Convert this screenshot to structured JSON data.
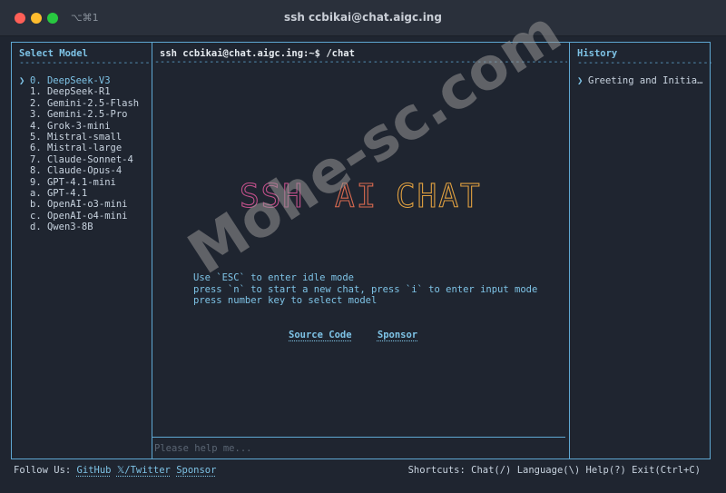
{
  "window": {
    "title": "ssh ccbikai@chat.aigc.ing",
    "tab_shortcut": "⌥⌘1"
  },
  "left_panel": {
    "title": "Select Model",
    "dashes": "--------------------------",
    "marker": "❯",
    "models": [
      {
        "key": "0.",
        "name": "DeepSeek-V3",
        "selected": true
      },
      {
        "key": "1.",
        "name": "DeepSeek-R1"
      },
      {
        "key": "2.",
        "name": "Gemini-2.5-Flash"
      },
      {
        "key": "3.",
        "name": "Gemini-2.5-Pro"
      },
      {
        "key": "4.",
        "name": "Grok-3-mini"
      },
      {
        "key": "5.",
        "name": "Mistral-small"
      },
      {
        "key": "6.",
        "name": "Mistral-large"
      },
      {
        "key": "7.",
        "name": "Claude-Sonnet-4"
      },
      {
        "key": "8.",
        "name": "Claude-Opus-4"
      },
      {
        "key": "9.",
        "name": "GPT-4.1-mini"
      },
      {
        "key": "a.",
        "name": "GPT-4.1"
      },
      {
        "key": "b.",
        "name": "OpenAI-o3-mini"
      },
      {
        "key": "c.",
        "name": "OpenAI-o4-mini"
      },
      {
        "key": "d.",
        "name": "Qwen3-8B"
      }
    ]
  },
  "main": {
    "prompt_title": "ssh ccbikai@chat.aigc.ing:~$ /chat",
    "dashes": "------------------------------------------------------------------------------------------",
    "banner": {
      "words": [
        "SSH",
        "AI",
        "CHAT"
      ],
      "colors": [
        "#c0508a",
        "#d96a50",
        "#e0a040"
      ]
    },
    "help_lines": [
      "Use `ESC` to enter idle mode",
      "press `n` to start a new chat, press `i` to enter input mode",
      "press number key to select model"
    ],
    "links": {
      "source_code": "Source Code",
      "sponsor": "Sponsor"
    },
    "input": {
      "placeholder": "Please help me...",
      "value": ""
    }
  },
  "right_panel": {
    "title": "History",
    "dashes": "--------------------------",
    "marker": "❯",
    "items": [
      "Greeting and Initial Conversation"
    ]
  },
  "footer": {
    "follow_label": "Follow Us:",
    "github": "GitHub",
    "twitter": "𝕏/Twitter",
    "sponsor": "Sponsor",
    "shortcuts": "Shortcuts: Chat(/) Language(\\) Help(?) Exit(Ctrl+C)"
  },
  "watermark": "Mohe-sc.com",
  "colors": {
    "accent": "#7ec3e6",
    "border": "#5fa8d3",
    "background": "#1f2530"
  }
}
